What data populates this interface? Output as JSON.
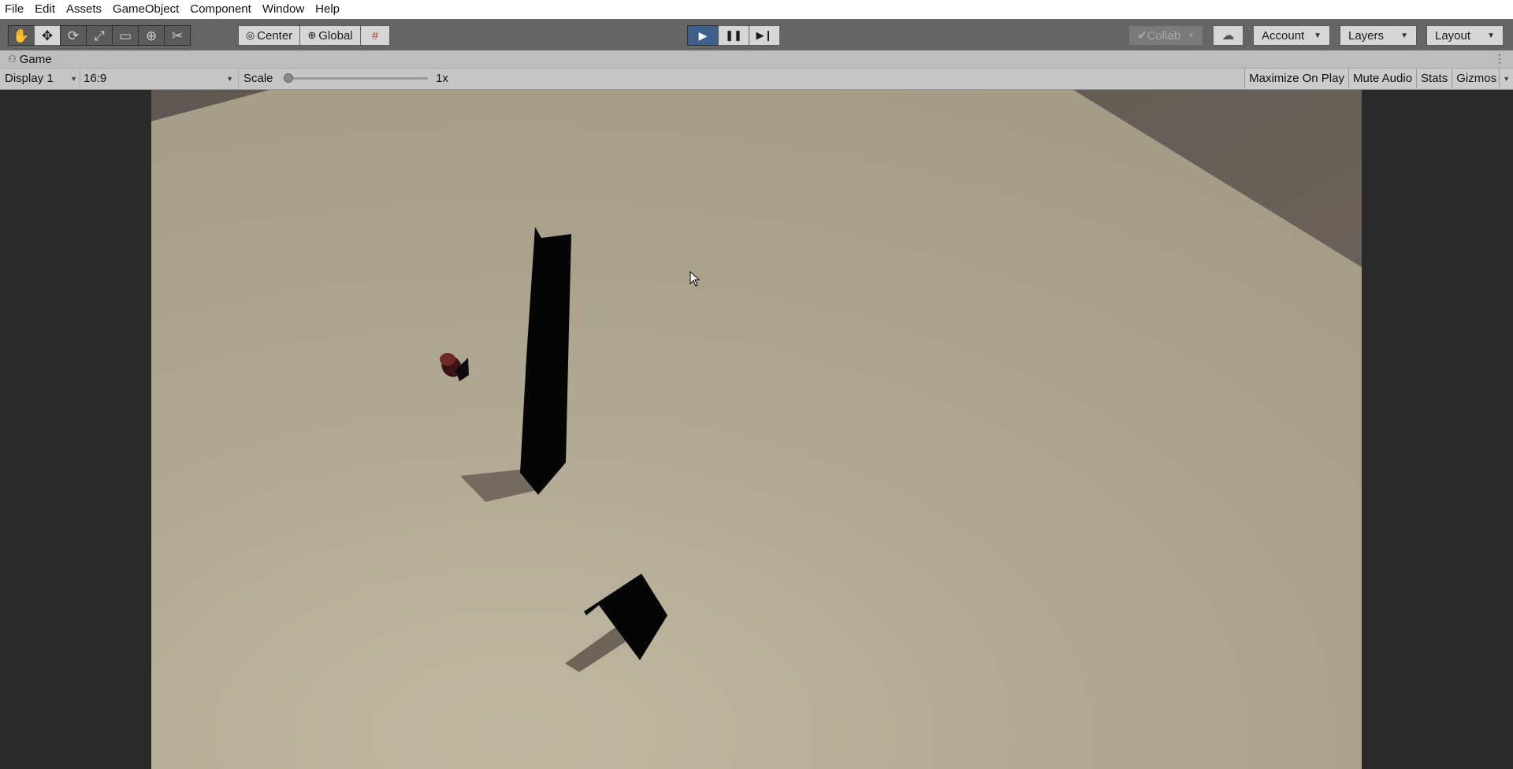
{
  "menu": [
    "File",
    "Edit",
    "Assets",
    "GameObject",
    "Component",
    "Window",
    "Help"
  ],
  "toolbar": {
    "tools": [
      {
        "name": "hand-tool-icon",
        "glyph": "✋"
      },
      {
        "name": "move-tool-icon",
        "glyph": "✥"
      },
      {
        "name": "rotate-tool-icon",
        "glyph": "⟳"
      },
      {
        "name": "scale-tool-icon",
        "glyph": "⤢"
      },
      {
        "name": "rect-tool-icon",
        "glyph": "▭"
      },
      {
        "name": "transform-tool-icon",
        "glyph": "⊕"
      },
      {
        "name": "custom-tool-icon",
        "glyph": "✂"
      }
    ],
    "pivot_label": "Center",
    "space_label": "Global",
    "collab_label": "Collab",
    "account_label": "Account",
    "layers_label": "Layers",
    "layout_label": "Layout"
  },
  "tab": {
    "label": "Game"
  },
  "game_bar": {
    "display": "Display 1",
    "aspect": "16:9",
    "scale_label": "Scale",
    "scale_value": "1x",
    "scale_slider_level": 0,
    "maximize": "Maximize On Play",
    "mute": "Mute Audio",
    "stats": "Stats",
    "gizmos": "Gizmos"
  },
  "colors": {
    "play_active": "#3e5f8a",
    "floor": "#a79f8b",
    "wall": "#686059",
    "toolbar": "#656565"
  }
}
